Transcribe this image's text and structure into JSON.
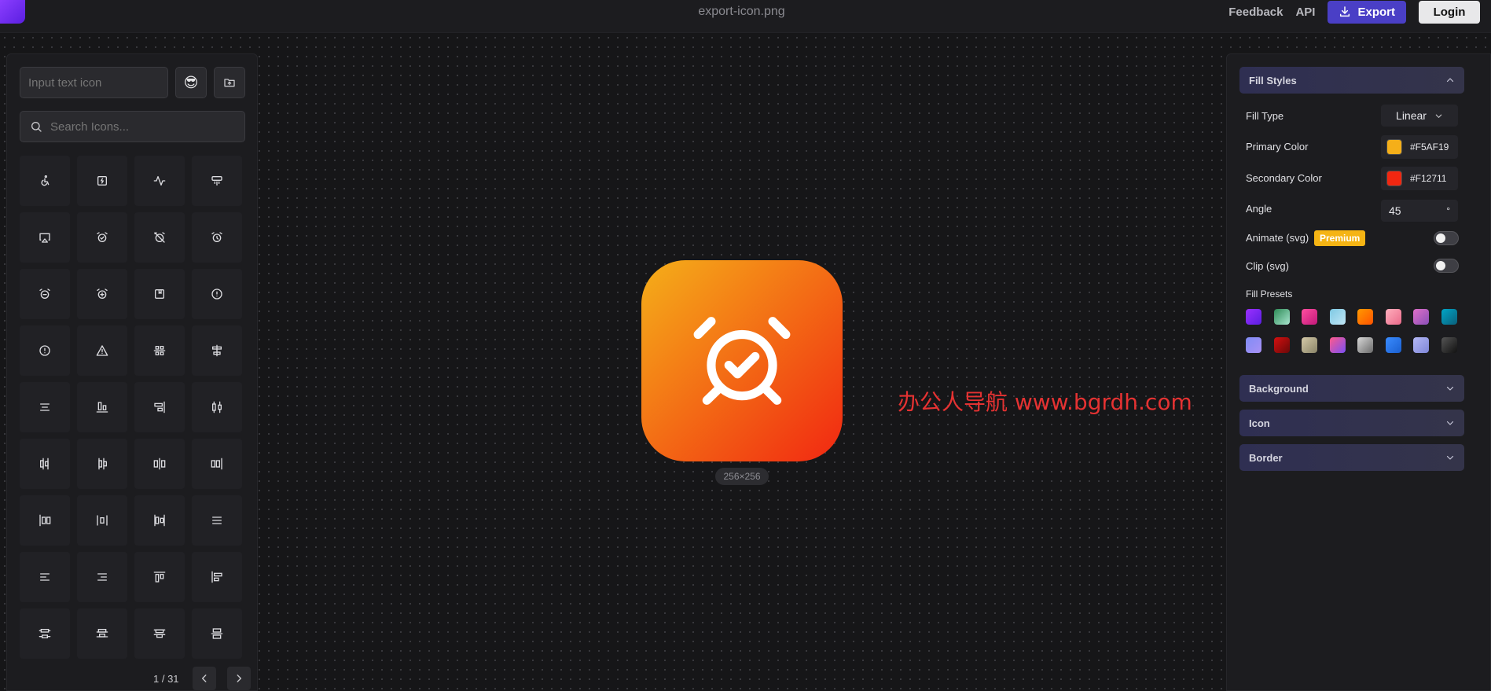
{
  "topbar": {
    "file_title": "export-icon.png",
    "feedback": "Feedback",
    "api": "API",
    "export": "Export",
    "login": "Login"
  },
  "left": {
    "text_placeholder": "Input text icon",
    "emoji": "😎",
    "search_placeholder": "Search Icons...",
    "icons": [
      "wheelchair-icon",
      "battery-charging-icon",
      "activity-icon",
      "ad-hoc-icon",
      "airplay-icon",
      "alarm-clock-check-icon",
      "alarm-clock-off-icon",
      "alarm-clock-icon",
      "alarm-minus-icon",
      "alarm-plus-icon",
      "album-icon",
      "alert-circle-icon",
      "alert-octagon-icon",
      "alert-triangle-icon",
      "align-center-horizontal-icon",
      "align-center-vertical-icon",
      "align-center-icon",
      "align-end-horizontal-icon",
      "align-end-vertical-icon",
      "align-h-distribute-center-icon",
      "align-h-distribute-end-icon",
      "align-h-distribute-start-icon",
      "align-h-justify-center-icon",
      "align-h-justify-end-icon",
      "align-h-justify-start-icon",
      "align-h-space-around-icon",
      "align-h-space-between-icon",
      "align-justify-icon",
      "align-left-icon",
      "align-right-icon",
      "align-start-horizontal-icon",
      "align-start-vertical-icon",
      "align-v-distribute-center-icon",
      "align-v-distribute-end-icon",
      "align-v-distribute-start-icon",
      "align-v-justify-center-icon"
    ],
    "page": "1 / 31"
  },
  "preview": {
    "size": "256×256",
    "icon": "alarm-clock-check-icon",
    "gradient_start": "#F5AF19",
    "gradient_end": "#F12711"
  },
  "watermark": "办公人导航 www.bgrdh.com",
  "right": {
    "fill_styles": "Fill Styles",
    "fill_type_label": "Fill Type",
    "fill_type_value": "Linear",
    "primary_label": "Primary Color",
    "primary_value": "#F5AF19",
    "secondary_label": "Secondary Color",
    "secondary_value": "#F12711",
    "angle_label": "Angle",
    "angle_value": "45",
    "angle_unit": "°",
    "animate_label": "Animate (svg)",
    "premium": "Premium",
    "clip_label": "Clip (svg)",
    "presets_label": "Fill Presets",
    "presets": [
      "linear-gradient(135deg,#9b30ff,#5a1fe0)",
      "linear-gradient(135deg,#2e8b57,#a8e6cf)",
      "linear-gradient(135deg,#ff4fa0,#c2187a)",
      "linear-gradient(135deg,#7ec8e3,#c1e6f5)",
      "linear-gradient(135deg,#ff9a00,#ff5200)",
      "linear-gradient(135deg,#ffafbd,#ea6a8a)",
      "linear-gradient(135deg,#e070c8,#8a4fb8)",
      "linear-gradient(135deg,#00a6c8,#0b5f7a)",
      "linear-gradient(135deg,#7f8cf5,#a991f5)",
      "linear-gradient(135deg,#d41010,#6a0808)",
      "linear-gradient(135deg,#d4c9a8,#8a8468)",
      "linear-gradient(135deg,#ff5a8a,#7a4ff5)",
      "linear-gradient(135deg,#d8d8d8,#6a6a6a)",
      "linear-gradient(135deg,#3a8cff,#1a5fd0)",
      "linear-gradient(135deg,#b4b8f5,#7e86d8)",
      "linear-gradient(135deg,#555,#111)"
    ],
    "background": "Background",
    "icon": "Icon",
    "border": "Border"
  }
}
